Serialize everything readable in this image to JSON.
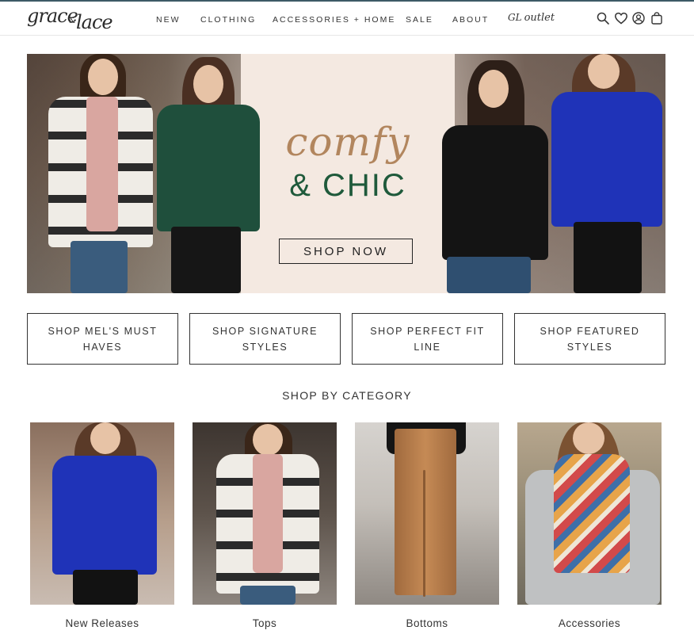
{
  "brand": {
    "logo_word1": "grace",
    "logo_amp": "&",
    "logo_word2": "lace"
  },
  "nav": {
    "items": [
      "NEW",
      "CLOTHING",
      "ACCESSORIES + HOME",
      "SALE",
      "ABOUT"
    ],
    "outlet_mark": "GL",
    "outlet_label": "outlet"
  },
  "header_icons": [
    "search-icon",
    "heart-icon",
    "account-icon",
    "bag-icon"
  ],
  "hero": {
    "script_text": "comfy",
    "main_text": "& CHIC",
    "button_label": "SHOP NOW"
  },
  "shop_buttons": [
    "SHOP MEL'S MUST HAVES",
    "SHOP SIGNATURE STYLES",
    "SHOP PERFECT FIT LINE",
    "SHOP FEATURED STYLES"
  ],
  "category_section": {
    "title": "SHOP BY CATEGORY",
    "items": [
      "New Releases",
      "Tops",
      "Bottoms",
      "Accessories"
    ]
  },
  "colors": {
    "accent_green": "#1f5a3b",
    "accent_tan": "#b2865e",
    "header_line": "#3d5a66"
  }
}
